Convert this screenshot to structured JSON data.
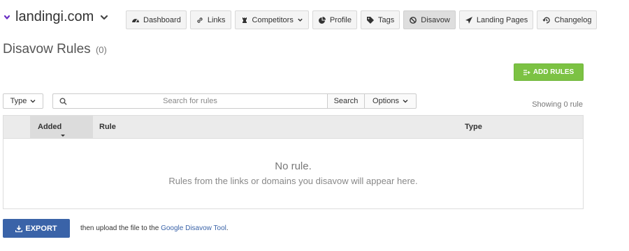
{
  "header": {
    "site_name": "landingi.com"
  },
  "nav": {
    "items": [
      {
        "label": "Dashboard",
        "icon": "dashboard-icon"
      },
      {
        "label": "Links",
        "icon": "link-icon"
      },
      {
        "label": "Competitors",
        "icon": "rook-icon",
        "has_dropdown": true
      },
      {
        "label": "Profile",
        "icon": "pie-chart-icon"
      },
      {
        "label": "Tags",
        "icon": "tag-icon"
      },
      {
        "label": "Disavow",
        "icon": "ban-icon",
        "active": true
      },
      {
        "label": "Landing Pages",
        "icon": "send-icon"
      },
      {
        "label": "Changelog",
        "icon": "history-icon"
      }
    ]
  },
  "page": {
    "title": "Disavow Rules",
    "count": "(0)"
  },
  "actions": {
    "add_rules_label": "ADD RULES"
  },
  "toolbar": {
    "type_filter_label": "Type",
    "search_placeholder": "Search for rules",
    "search_value": "",
    "search_button_label": "Search",
    "options_label": "Options",
    "showing_text": "Showing 0 rule"
  },
  "table": {
    "columns": [
      "Added",
      "Rule",
      "Type"
    ],
    "empty_title": "No rule.",
    "empty_subtitle": "Rules from the links or domains you disavow will appear here."
  },
  "footer": {
    "export_label": "EXPORT",
    "note_prefix": "then upload the file to the ",
    "note_link": "Google Disavow Tool",
    "note_suffix": "."
  },
  "colors": {
    "accent_purple": "#6a2fc4",
    "add_green": "#7cc243",
    "export_blue": "#3a63a8"
  }
}
